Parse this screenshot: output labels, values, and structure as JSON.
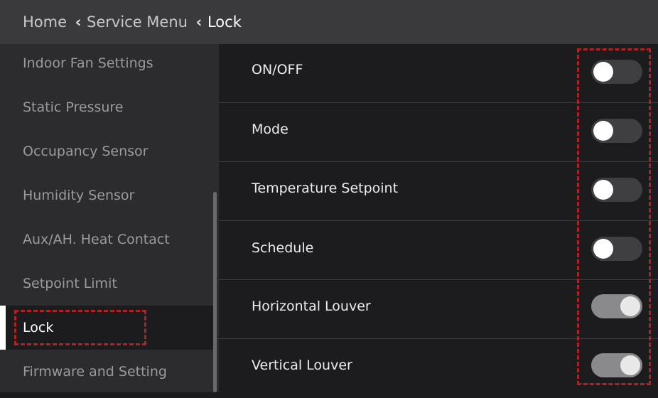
{
  "header": {
    "breadcrumbs": [
      "Home",
      "Service Menu",
      "Lock"
    ],
    "chevron_icon": "chevron-left-icon"
  },
  "sidebar": {
    "items": [
      {
        "label": "Indoor Fan Settings",
        "selected": false
      },
      {
        "label": "Static Pressure",
        "selected": false
      },
      {
        "label": "Occupancy Sensor",
        "selected": false
      },
      {
        "label": "Humidity Sensor",
        "selected": false
      },
      {
        "label": "Aux/AH. Heat Contact",
        "selected": false
      },
      {
        "label": "Setpoint Limit",
        "selected": false
      },
      {
        "label": "Lock",
        "selected": true
      },
      {
        "label": "Firmware and Setting",
        "selected": false
      }
    ]
  },
  "main": {
    "rows": [
      {
        "label": "ON/OFF",
        "enabled": false
      },
      {
        "label": "Mode",
        "enabled": false
      },
      {
        "label": "Temperature Setpoint",
        "enabled": false
      },
      {
        "label": "Schedule",
        "enabled": false
      },
      {
        "label": "Horizontal Louver",
        "enabled": true
      },
      {
        "label": "Vertical Louver",
        "enabled": true
      }
    ]
  },
  "colors": {
    "header_bg": "#3a3a3c",
    "sidebar_bg": "#2c2c2e",
    "main_bg": "#1c1c1e",
    "highlight_dash": "#b22222",
    "toggle_off": "#3f3f42",
    "toggle_on": "#8a8a8d"
  }
}
